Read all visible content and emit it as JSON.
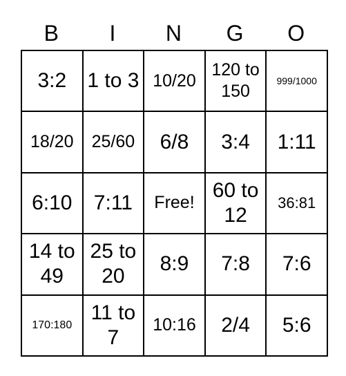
{
  "header": [
    "B",
    "I",
    "N",
    "G",
    "O"
  ],
  "rows": [
    [
      "3:2",
      "1 to 3",
      "10/20",
      "120 to 150",
      "999/1000"
    ],
    [
      "18/20",
      "25/60",
      "6/8",
      "3:4",
      "1:11"
    ],
    [
      "6:10",
      "7:11",
      "Free!",
      "60 to 12",
      "36:81"
    ],
    [
      "14 to 49",
      "25 to 20",
      "8:9",
      "7:8",
      "7:6"
    ],
    [
      "170:180",
      "11 to 7",
      "10:16",
      "2/4",
      "5:6"
    ]
  ]
}
